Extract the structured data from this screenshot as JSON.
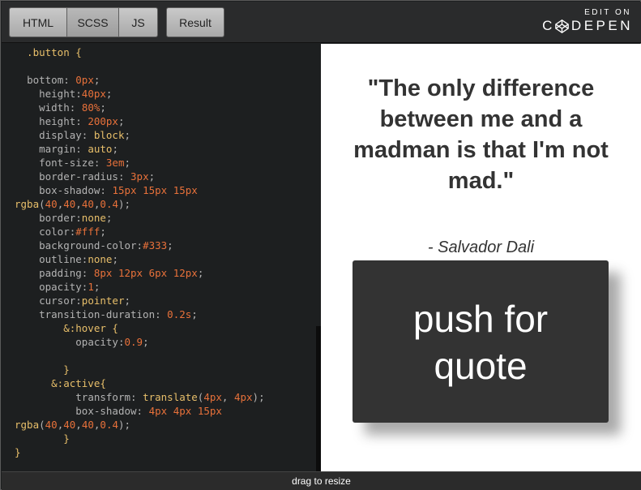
{
  "tabs": {
    "html": "HTML",
    "scss": "SCSS",
    "js": "JS",
    "result": "Result"
  },
  "logo": {
    "edit_on": "EDIT ON",
    "brand_start": "C",
    "brand_end": "DEPEN"
  },
  "code_lines": [
    "  .button {",
    "",
    "  bottom: 0px;",
    "    height:40px;",
    "    width: 80%;",
    "    height: 200px;",
    "    display: block;",
    "    margin: auto;",
    "    font-size: 3em;",
    "    border-radius: 3px;",
    "    box-shadow: 15px 15px 15px",
    "rgba(40,40,40,0.4);",
    "    border:none;",
    "    color:#fff;",
    "    background-color:#333;",
    "    outline:none;",
    "    padding: 8px 12px 6px 12px;",
    "    opacity:1;",
    "    cursor:pointer;",
    "    transition-duration: 0.2s;",
    "        &:hover {",
    "          opacity:0.9;",
    "",
    "        }",
    "      &:active{",
    "          transform: translate(4px, 4px);",
    "          box-shadow: 4px 4px 15px",
    "rgba(40,40,40,0.4);",
    "        }",
    "}"
  ],
  "preview": {
    "quote": "\"The only difference between me and a madman is that I'm not mad.\"",
    "author": "- Salvador Dali",
    "button_label": "push for quote"
  },
  "footer": {
    "resize_label": "drag to resize"
  },
  "colors": {
    "code_bg": "#1d1f20",
    "selector": "#e8bf6a",
    "value": "#e8713a",
    "property": "#b3b3b3",
    "button_bg": "#333333"
  }
}
